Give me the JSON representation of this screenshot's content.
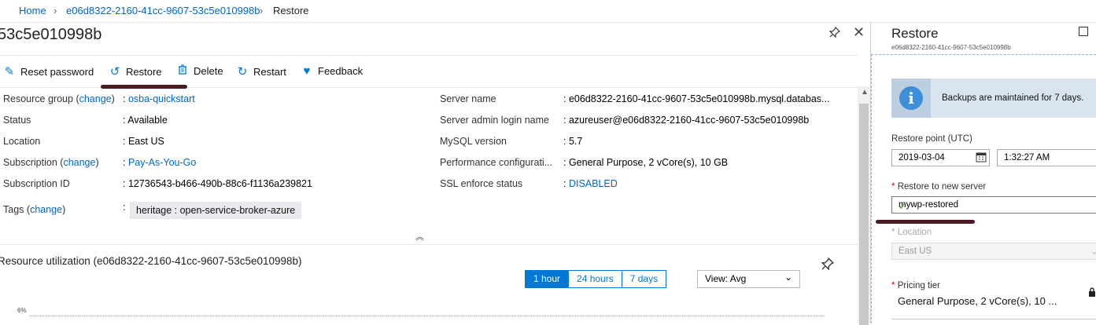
{
  "breadcrumb": {
    "home": "Home",
    "server": "e06d8322-2160-41cc-9607-53c5e010998b",
    "current": "Restore",
    "sep": "›"
  },
  "blade": {
    "title": "53c5e010998b",
    "commands": [
      {
        "label": "Reset password",
        "icon": "pencil-icon"
      },
      {
        "label": "Restore",
        "icon": "restore-icon"
      },
      {
        "label": "Delete",
        "icon": "trash-icon"
      },
      {
        "label": "Restart",
        "icon": "restart-icon"
      },
      {
        "label": "Feedback",
        "icon": "heart-icon"
      }
    ],
    "essentials_left": [
      {
        "label": "Resource group",
        "change": "change",
        "value": "osba-quickstart",
        "link": true
      },
      {
        "label": "Status",
        "value": "Available"
      },
      {
        "label": "Location",
        "value": "East US"
      },
      {
        "label": "Subscription",
        "change": "change",
        "value": "Pay-As-You-Go",
        "link": true
      },
      {
        "label": "Subscription ID",
        "value": "12736543-b466-490b-88c6-f1136a239821"
      },
      {
        "label": "Tags",
        "change": "change",
        "value": "heritage : open-service-broker-azure"
      }
    ],
    "essentials_right": [
      {
        "label": "Server name",
        "value": "e06d8322-2160-41cc-9607-53c5e010998b.mysql.databas..."
      },
      {
        "label": "Server admin login name",
        "value": "azureuser@e06d8322-2160-41cc-9607-53c5e010998b"
      },
      {
        "label": "MySQL version",
        "value": "5.7"
      },
      {
        "label": "Performance configurati...",
        "value": "General Purpose, 2 vCore(s), 10 GB"
      },
      {
        "label": "SSL enforce status",
        "value": "DISABLED",
        "link": true
      }
    ],
    "resource_util": {
      "title": "Resource utilization (e06d8322-2160-41cc-9607-53c5e010998b)",
      "ranges": [
        "1 hour",
        "24 hours",
        "7 days"
      ],
      "selected_range": "1 hour",
      "view": "View: Avg",
      "y_label": "6%"
    }
  },
  "restore": {
    "title": "Restore",
    "subtitle": "e06d8322-2160-41cc-9607-53c5e010998b",
    "info": "Backups are maintained for 7 days.",
    "restore_point_label": "Restore point (UTC)",
    "date": "2019-03-04",
    "time": "1:32:27 AM",
    "new_server_label": "Restore to new server",
    "new_server_value": "mywp-restored",
    "location_label": "Location",
    "location_value": "East US",
    "pricing_label": "Pricing tier",
    "pricing_value": "General Purpose, 2 vCore(s), 10 ..."
  },
  "colors": {
    "accent": "#0078d4",
    "annotation": "#4a1b22"
  }
}
